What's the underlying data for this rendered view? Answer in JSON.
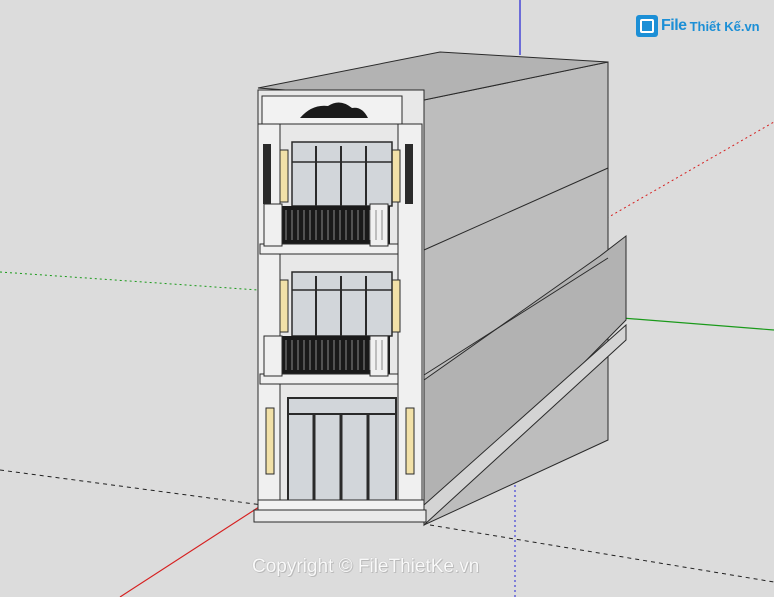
{
  "watermark": {
    "logo_file": "File",
    "logo_rest": "Thiết Kế.vn",
    "copyright": "Copyright © FileThietKe.vn"
  },
  "colors": {
    "background": "#dcdcdc",
    "axis_red": "#d62020",
    "axis_green": "#1a9a1a",
    "axis_blue": "#2020d6",
    "wall_light": "#e6e6e6",
    "wall_side": "#bdbdbd",
    "roof": "#b3b3b3",
    "trim": "#f2f2f2",
    "accent_panel": "#f2e1a8",
    "glass": "#d2d6da",
    "railing": "#1a1a1a",
    "logo_blue": "#1c8fd6"
  },
  "scene": {
    "model": "three-storey townhouse facade",
    "camera": "perspective",
    "axes": [
      "red",
      "green",
      "blue"
    ]
  }
}
